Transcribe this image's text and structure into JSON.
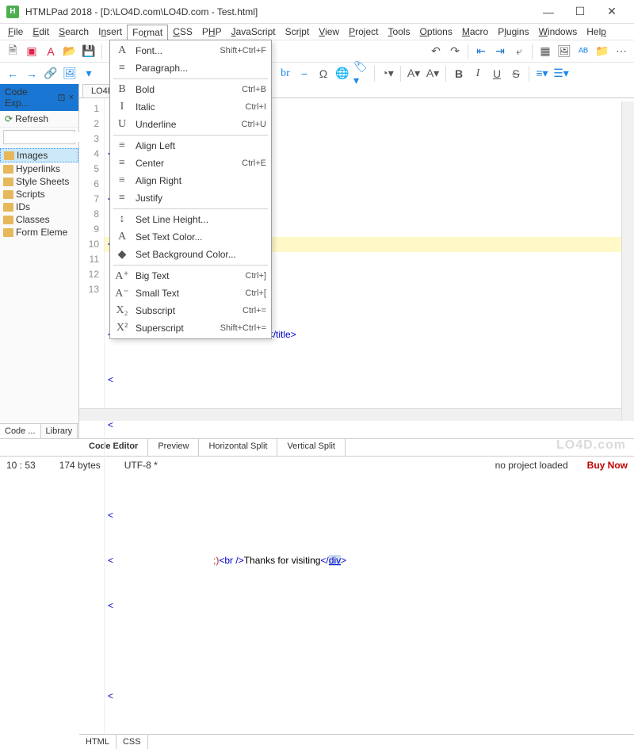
{
  "titlebar": {
    "app": "HTMLPad 2018",
    "path": "[D:\\LO4D.com\\LO4D.com - Test.html]"
  },
  "menubar": [
    "File",
    "Edit",
    "Search",
    "Insert",
    "Format",
    "CSS",
    "PHP",
    "JavaScript",
    "Script",
    "View",
    "Project",
    "Tools",
    "Options",
    "Macro",
    "Plugins",
    "Windows",
    "Help"
  ],
  "format_menu": [
    {
      "icon": "A",
      "label": "Font...",
      "short": "Shift+Ctrl+F"
    },
    {
      "icon": "≡",
      "label": "Paragraph...",
      "short": ""
    },
    {
      "sep": true
    },
    {
      "icon": "B",
      "label": "Bold",
      "short": "Ctrl+B"
    },
    {
      "icon": "I",
      "label": "Italic",
      "short": "Ctrl+I"
    },
    {
      "icon": "U",
      "label": "Underline",
      "short": "Ctrl+U"
    },
    {
      "sep": true
    },
    {
      "icon": "≡",
      "label": "Align Left",
      "short": ""
    },
    {
      "icon": "≡",
      "label": "Center",
      "short": "Ctrl+E"
    },
    {
      "icon": "≡",
      "label": "Align Right",
      "short": ""
    },
    {
      "icon": "≡",
      "label": "Justify",
      "short": ""
    },
    {
      "sep": true
    },
    {
      "icon": "↕",
      "label": "Set Line Height...",
      "short": ""
    },
    {
      "icon": "A",
      "label": "Set Text Color...",
      "short": ""
    },
    {
      "icon": "◆",
      "label": "Set Background Color...",
      "short": ""
    },
    {
      "sep": true
    },
    {
      "icon": "A⁺",
      "label": "Big Text",
      "short": "Ctrl+]"
    },
    {
      "icon": "A⁻",
      "label": "Small Text",
      "short": "Ctrl+["
    },
    {
      "icon": "X₂",
      "label": "Subscript",
      "short": "Ctrl+="
    },
    {
      "icon": "X²",
      "label": "Superscript",
      "short": "Shift+Ctrl+="
    }
  ],
  "sidebar": {
    "title": "Code Exp...",
    "pin": "⊡",
    "refresh": "Refresh",
    "search_placeholder": "",
    "items": [
      "Images",
      "Hyperlinks",
      "Style Sheets",
      "Scripts",
      "IDs",
      "Classes",
      "Form Eleme"
    ],
    "tabs": [
      "Code ...",
      "Library"
    ]
  },
  "file_tab": "LO4D",
  "code": {
    "line_start": 1,
    "line_count": 13,
    "visible_fragments": {
      "line5_tail": "ome!</title>",
      "line10_tail": ";)<br />Thanks for visiting</div>"
    },
    "highlighted_line": 10
  },
  "bottom_tabs": [
    "HTML",
    "CSS"
  ],
  "view_tabs": [
    "Code Editor",
    "Preview",
    "Horizontal Split",
    "Vertical Split"
  ],
  "toolbar2_labels": {
    "br": "br"
  },
  "status": {
    "pos": "10 : 53",
    "bytes": "174 bytes",
    "enc": "UTF-8 *",
    "project": "no project loaded",
    "buy": "Buy Now"
  },
  "watermark": "LO4D.com"
}
